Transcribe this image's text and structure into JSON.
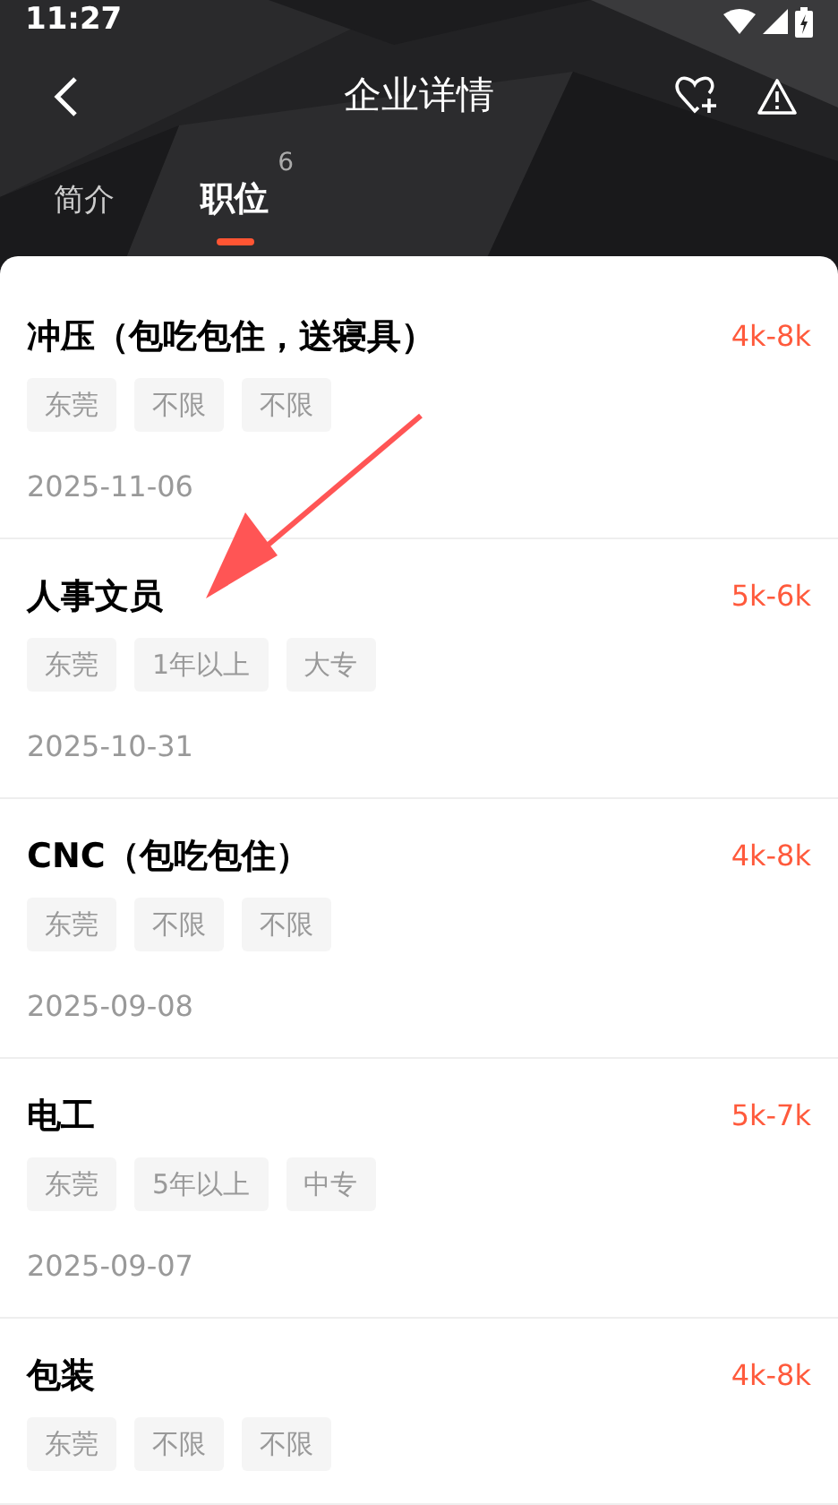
{
  "status_bar": {
    "time": "11:27"
  },
  "header": {
    "title": "企业详情"
  },
  "tabs": [
    {
      "label": "简介",
      "selected": false
    },
    {
      "label": "职位",
      "selected": true,
      "count": "6"
    }
  ],
  "jobs": [
    {
      "title": "冲压（包吃包住，送寝具）",
      "salary": "4k-8k",
      "tags": [
        "东莞",
        "不限",
        "不限"
      ],
      "date": "2025-11-06"
    },
    {
      "title": "人事文员",
      "salary": "5k-6k",
      "tags": [
        "东莞",
        "1年以上",
        "大专"
      ],
      "date": "2025-10-31"
    },
    {
      "title": "CNC（包吃包住）",
      "salary": "4k-8k",
      "tags": [
        "东莞",
        "不限",
        "不限"
      ],
      "date": "2025-09-08"
    },
    {
      "title": "电工",
      "salary": "5k-7k",
      "tags": [
        "东莞",
        "5年以上",
        "中专"
      ],
      "date": "2025-09-07"
    },
    {
      "title": "包装",
      "salary": "4k-8k",
      "tags": [
        "东莞",
        "不限",
        "不限"
      ]
    }
  ]
}
